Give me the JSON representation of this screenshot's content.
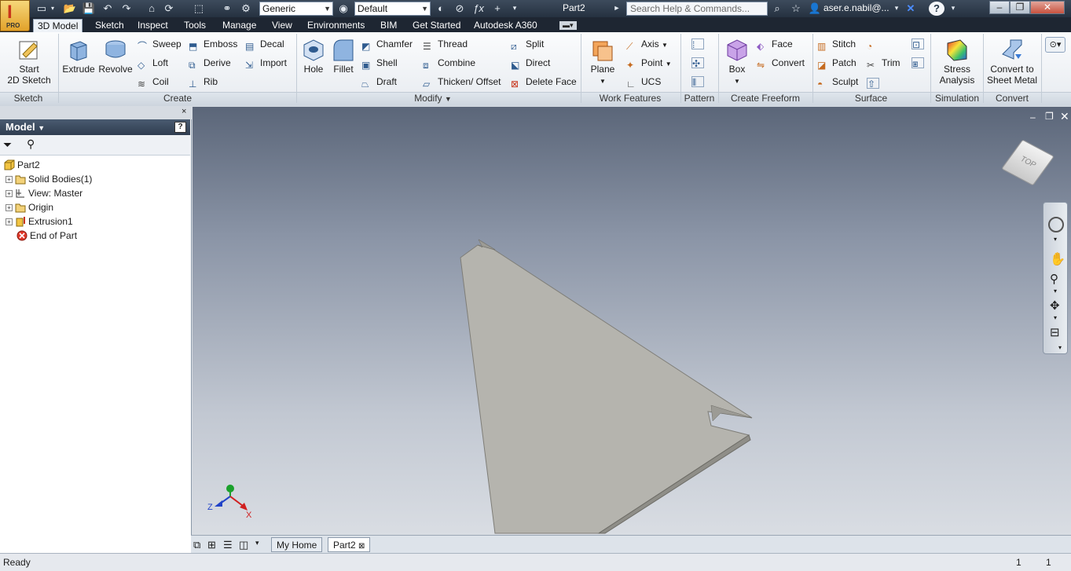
{
  "title_bar": {
    "logo_letter": "I",
    "logo_edition": "PRO",
    "material_value": "Generic",
    "appearance_value": "Default",
    "document_title": "Part2",
    "search_placeholder": "Search Help & Commands...",
    "user_name": "aser.e.nabil@...",
    "help_label": "?"
  },
  "tabs": [
    {
      "label": "3D Model"
    },
    {
      "label": "Sketch"
    },
    {
      "label": "Inspect"
    },
    {
      "label": "Tools"
    },
    {
      "label": "Manage"
    },
    {
      "label": "View"
    },
    {
      "label": "Environments"
    },
    {
      "label": "BIM"
    },
    {
      "label": "Get Started"
    },
    {
      "label": "Autodesk A360"
    }
  ],
  "ribbon": {
    "sketch": {
      "start_line1": "Start",
      "start_line2": "2D Sketch",
      "panel": "Sketch"
    },
    "create": {
      "extrude": "Extrude",
      "revolve": "Revolve",
      "sweep": "Sweep",
      "loft": "Loft",
      "coil": "Coil",
      "emboss": "Emboss",
      "derive": "Derive",
      "rib": "Rib",
      "decal": "Decal",
      "import": "Import",
      "panel": "Create"
    },
    "modify": {
      "hole": "Hole",
      "fillet": "Fillet",
      "chamfer": "Chamfer",
      "shell": "Shell",
      "draft": "Draft",
      "thread": "Thread",
      "combine": "Combine",
      "thicken": "Thicken/ Offset",
      "split": "Split",
      "direct": "Direct",
      "delete_face": "Delete Face",
      "panel": "Modify"
    },
    "work_features": {
      "plane": "Plane",
      "axis": "Axis",
      "point": "Point",
      "ucs": "UCS",
      "panel": "Work Features"
    },
    "pattern": {
      "panel": "Pattern"
    },
    "freeform": {
      "box": "Box",
      "face": "Face",
      "convert": "Convert",
      "panel": "Create Freeform"
    },
    "surface": {
      "stitch": "Stitch",
      "patch": "Patch",
      "sculpt": "Sculpt",
      "trim": "Trim",
      "panel": "Surface"
    },
    "simulation": {
      "line1": "Stress",
      "line2": "Analysis",
      "panel": "Simulation"
    },
    "convert": {
      "line1": "Convert to",
      "line2": "Sheet Metal",
      "panel": "Convert"
    }
  },
  "browser": {
    "title": "Model",
    "help_label": "?",
    "items": [
      {
        "label": "Part2"
      },
      {
        "label": "Solid Bodies(1)"
      },
      {
        "label": "View: Master"
      },
      {
        "label": "Origin"
      },
      {
        "label": "Extrusion1"
      },
      {
        "label": "End of Part"
      }
    ]
  },
  "viewport": {
    "viewcube_label": "TOP",
    "axis_x": "X",
    "axis_z": "Z"
  },
  "doc_tabs": {
    "home": "My Home",
    "part": "Part2",
    "close_glyph": "⊠"
  },
  "status_bar": {
    "text": "Ready",
    "count1": "1",
    "count2": "1"
  },
  "colors": {
    "title_bg": "#253140",
    "tab_bg": "#1e2632",
    "part_fill": "#b5b4ae",
    "part_edge": "#7e7d77"
  }
}
